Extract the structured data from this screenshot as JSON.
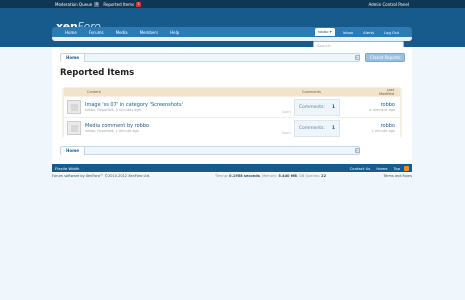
{
  "modbar": {
    "items": [
      {
        "label": "Moderation Queue",
        "count": "0"
      },
      {
        "label": "Reported Items",
        "count": "1"
      }
    ],
    "admin_label": "Admin Control Panel"
  },
  "logo": {
    "text_a": "xen",
    "text_b": "Foro"
  },
  "nav": {
    "tabs": [
      "Home",
      "Forums",
      "Media",
      "Members",
      "Help"
    ],
    "user_tabs": [
      "robbo",
      "Inbox",
      "Alerts",
      "Log Out"
    ],
    "user_caret": "▾"
  },
  "search": {
    "placeholder": "Search..."
  },
  "breadcrumb": {
    "home": "Home",
    "jump_icon": "⇱"
  },
  "page": {
    "title": "Reported Items",
    "closed_button": "Closed Reports"
  },
  "list": {
    "headers": {
      "content": "Content",
      "comments": "Comments",
      "last": "Last Modified"
    },
    "rows": [
      {
        "title": "Image 'ss 07' in category 'Screenshots'",
        "meta": "robbo, Reported: 5 minutes ago",
        "type": "Sport",
        "comments_label": "Comments:",
        "comments": "1",
        "last_user": "robbo",
        "last_time": "a moment ago"
      },
      {
        "title": "Media comment by robbo",
        "meta": "robbo, Reported: 1 minute ago",
        "type": "Sport",
        "comments_label": "Comments:",
        "comments": "1",
        "last_user": "robbo",
        "last_time": "1 minute ago"
      }
    ]
  },
  "footer": {
    "style_label": "Flexile Width",
    "links": [
      "Contact Us",
      "Home",
      "Top"
    ],
    "copyright": "Forum software by XenForo™ ©2010-2012 XenForo Ltd.",
    "stats": {
      "timing_label": "Timing:",
      "timing_value": "0.1958 seconds",
      "memory_label": "Memory:",
      "memory_value": "5.440 MB",
      "queries_label": "DB Queries:",
      "queries_value": "22"
    },
    "terms": "Terms and Rules"
  }
}
